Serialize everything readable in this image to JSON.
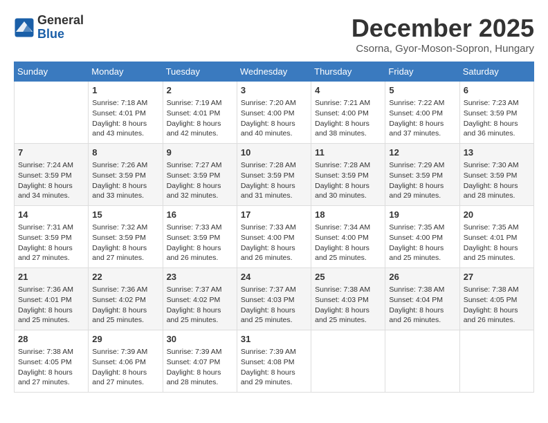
{
  "header": {
    "logo_general": "General",
    "logo_blue": "Blue",
    "month_title": "December 2025",
    "subtitle": "Csorna, Gyor-Moson-Sopron, Hungary"
  },
  "weekdays": [
    "Sunday",
    "Monday",
    "Tuesday",
    "Wednesday",
    "Thursday",
    "Friday",
    "Saturday"
  ],
  "weeks": [
    [
      {
        "day": "",
        "info": ""
      },
      {
        "day": "1",
        "info": "Sunrise: 7:18 AM\nSunset: 4:01 PM\nDaylight: 8 hours\nand 43 minutes."
      },
      {
        "day": "2",
        "info": "Sunrise: 7:19 AM\nSunset: 4:01 PM\nDaylight: 8 hours\nand 42 minutes."
      },
      {
        "day": "3",
        "info": "Sunrise: 7:20 AM\nSunset: 4:00 PM\nDaylight: 8 hours\nand 40 minutes."
      },
      {
        "day": "4",
        "info": "Sunrise: 7:21 AM\nSunset: 4:00 PM\nDaylight: 8 hours\nand 38 minutes."
      },
      {
        "day": "5",
        "info": "Sunrise: 7:22 AM\nSunset: 4:00 PM\nDaylight: 8 hours\nand 37 minutes."
      },
      {
        "day": "6",
        "info": "Sunrise: 7:23 AM\nSunset: 3:59 PM\nDaylight: 8 hours\nand 36 minutes."
      }
    ],
    [
      {
        "day": "7",
        "info": "Sunrise: 7:24 AM\nSunset: 3:59 PM\nDaylight: 8 hours\nand 34 minutes."
      },
      {
        "day": "8",
        "info": "Sunrise: 7:26 AM\nSunset: 3:59 PM\nDaylight: 8 hours\nand 33 minutes."
      },
      {
        "day": "9",
        "info": "Sunrise: 7:27 AM\nSunset: 3:59 PM\nDaylight: 8 hours\nand 32 minutes."
      },
      {
        "day": "10",
        "info": "Sunrise: 7:28 AM\nSunset: 3:59 PM\nDaylight: 8 hours\nand 31 minutes."
      },
      {
        "day": "11",
        "info": "Sunrise: 7:28 AM\nSunset: 3:59 PM\nDaylight: 8 hours\nand 30 minutes."
      },
      {
        "day": "12",
        "info": "Sunrise: 7:29 AM\nSunset: 3:59 PM\nDaylight: 8 hours\nand 29 minutes."
      },
      {
        "day": "13",
        "info": "Sunrise: 7:30 AM\nSunset: 3:59 PM\nDaylight: 8 hours\nand 28 minutes."
      }
    ],
    [
      {
        "day": "14",
        "info": "Sunrise: 7:31 AM\nSunset: 3:59 PM\nDaylight: 8 hours\nand 27 minutes."
      },
      {
        "day": "15",
        "info": "Sunrise: 7:32 AM\nSunset: 3:59 PM\nDaylight: 8 hours\nand 27 minutes."
      },
      {
        "day": "16",
        "info": "Sunrise: 7:33 AM\nSunset: 3:59 PM\nDaylight: 8 hours\nand 26 minutes."
      },
      {
        "day": "17",
        "info": "Sunrise: 7:33 AM\nSunset: 4:00 PM\nDaylight: 8 hours\nand 26 minutes."
      },
      {
        "day": "18",
        "info": "Sunrise: 7:34 AM\nSunset: 4:00 PM\nDaylight: 8 hours\nand 25 minutes."
      },
      {
        "day": "19",
        "info": "Sunrise: 7:35 AM\nSunset: 4:00 PM\nDaylight: 8 hours\nand 25 minutes."
      },
      {
        "day": "20",
        "info": "Sunrise: 7:35 AM\nSunset: 4:01 PM\nDaylight: 8 hours\nand 25 minutes."
      }
    ],
    [
      {
        "day": "21",
        "info": "Sunrise: 7:36 AM\nSunset: 4:01 PM\nDaylight: 8 hours\nand 25 minutes."
      },
      {
        "day": "22",
        "info": "Sunrise: 7:36 AM\nSunset: 4:02 PM\nDaylight: 8 hours\nand 25 minutes."
      },
      {
        "day": "23",
        "info": "Sunrise: 7:37 AM\nSunset: 4:02 PM\nDaylight: 8 hours\nand 25 minutes."
      },
      {
        "day": "24",
        "info": "Sunrise: 7:37 AM\nSunset: 4:03 PM\nDaylight: 8 hours\nand 25 minutes."
      },
      {
        "day": "25",
        "info": "Sunrise: 7:38 AM\nSunset: 4:03 PM\nDaylight: 8 hours\nand 25 minutes."
      },
      {
        "day": "26",
        "info": "Sunrise: 7:38 AM\nSunset: 4:04 PM\nDaylight: 8 hours\nand 26 minutes."
      },
      {
        "day": "27",
        "info": "Sunrise: 7:38 AM\nSunset: 4:05 PM\nDaylight: 8 hours\nand 26 minutes."
      }
    ],
    [
      {
        "day": "28",
        "info": "Sunrise: 7:38 AM\nSunset: 4:05 PM\nDaylight: 8 hours\nand 27 minutes."
      },
      {
        "day": "29",
        "info": "Sunrise: 7:39 AM\nSunset: 4:06 PM\nDaylight: 8 hours\nand 27 minutes."
      },
      {
        "day": "30",
        "info": "Sunrise: 7:39 AM\nSunset: 4:07 PM\nDaylight: 8 hours\nand 28 minutes."
      },
      {
        "day": "31",
        "info": "Sunrise: 7:39 AM\nSunset: 4:08 PM\nDaylight: 8 hours\nand 29 minutes."
      },
      {
        "day": "",
        "info": ""
      },
      {
        "day": "",
        "info": ""
      },
      {
        "day": "",
        "info": ""
      }
    ]
  ]
}
